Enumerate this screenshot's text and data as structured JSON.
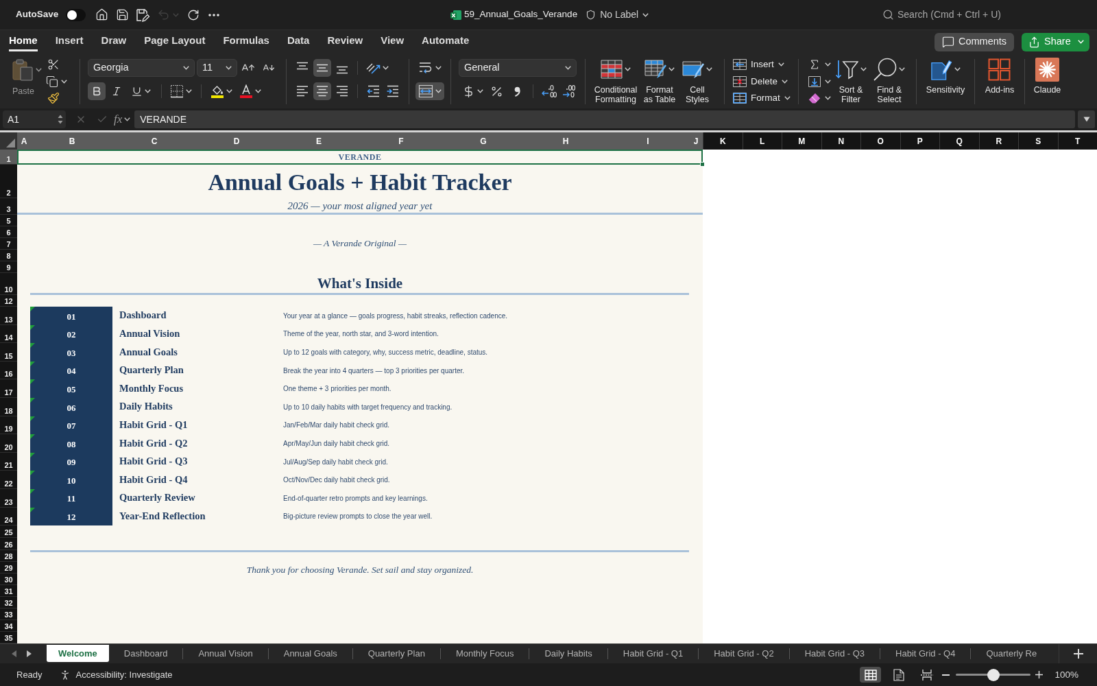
{
  "title_bar": {
    "autosave": {
      "label": "AutoSave",
      "on": false
    },
    "quick_access": [
      {
        "kind": "home",
        "disabled": false
      },
      {
        "kind": "save",
        "disabled": false
      },
      {
        "kind": "save_as",
        "disabled": false
      },
      {
        "kind": "undo",
        "disabled": true
      },
      {
        "kind": "redo",
        "disabled": false
      },
      {
        "kind": "more",
        "disabled": false
      }
    ],
    "file_name": "59_Annual_Goals_Verande",
    "sensitivity_label": "No Label",
    "search": {
      "placeholder": "Search (Cmd + Ctrl + U)"
    }
  },
  "ribbon_tabs": [
    {
      "label": "Home",
      "selected": true
    },
    {
      "label": "Insert",
      "selected": false
    },
    {
      "label": "Draw",
      "selected": false
    },
    {
      "label": "Page Layout",
      "selected": false
    },
    {
      "label": "Formulas",
      "selected": false
    },
    {
      "label": "Data",
      "selected": false
    },
    {
      "label": "Review",
      "selected": false
    },
    {
      "label": "View",
      "selected": false
    },
    {
      "label": "Automate",
      "selected": false
    }
  ],
  "ribbon": {
    "comments": "Comments",
    "share": "Share",
    "paste": {
      "label": "Paste",
      "disabled": true
    },
    "font_name": "Georgia",
    "font_size": "11",
    "font_styles": [
      {
        "kind": "bold",
        "selected": true
      },
      {
        "kind": "italic",
        "selected": false
      },
      {
        "kind": "underline",
        "selected": false
      }
    ],
    "vertical_align": [
      {
        "kind": "top",
        "selected": false
      },
      {
        "kind": "middle",
        "selected": true
      },
      {
        "kind": "bottom",
        "selected": false
      }
    ],
    "horizontal_align": [
      {
        "kind": "left",
        "selected": false
      },
      {
        "kind": "center",
        "selected": true
      },
      {
        "kind": "right",
        "selected": false
      }
    ],
    "merge_selected": true,
    "number_format": "General",
    "style_buttons": [
      {
        "kind": "conditional_formatting",
        "lines": [
          "Conditional",
          "Formatting"
        ]
      },
      {
        "kind": "format_as_table",
        "lines": [
          "Format",
          "as Table"
        ]
      },
      {
        "kind": "cell_styles",
        "lines": [
          "Cell",
          "Styles"
        ]
      }
    ],
    "cell_actions": [
      {
        "kind": "insert",
        "label": "Insert"
      },
      {
        "kind": "delete",
        "label": "Delete"
      },
      {
        "kind": "format",
        "label": "Format"
      }
    ],
    "editing_buttons": [
      {
        "kind": "sort_filter",
        "lines": [
          "Sort &",
          "Filter"
        ]
      },
      {
        "kind": "find_select",
        "lines": [
          "Find &",
          "Select"
        ]
      }
    ],
    "extra_buttons": [
      {
        "kind": "sensitivity",
        "label": "Sensitivity"
      },
      {
        "kind": "add_ins",
        "label": "Add-ins"
      },
      {
        "kind": "claude",
        "label": "Claude"
      }
    ]
  },
  "formula_bar": {
    "name_box": "A1",
    "function_label": "fx",
    "formula": "VERANDE"
  },
  "columns": [
    {
      "label": "A",
      "selected": true
    },
    {
      "label": "B",
      "selected": true
    },
    {
      "label": "C",
      "selected": true
    },
    {
      "label": "D",
      "selected": true
    },
    {
      "label": "E",
      "selected": true
    },
    {
      "label": "F",
      "selected": true
    },
    {
      "label": "G",
      "selected": true
    },
    {
      "label": "H",
      "selected": true
    },
    {
      "label": "I",
      "selected": true
    },
    {
      "label": "J",
      "selected": true
    },
    {
      "label": "K",
      "selected": false
    },
    {
      "label": "L",
      "selected": false
    },
    {
      "label": "M",
      "selected": false
    },
    {
      "label": "N",
      "selected": false
    },
    {
      "label": "O",
      "selected": false
    },
    {
      "label": "P",
      "selected": false
    },
    {
      "label": "Q",
      "selected": false
    },
    {
      "label": "R",
      "selected": false
    },
    {
      "label": "S",
      "selected": false
    },
    {
      "label": "T",
      "selected": false
    }
  ],
  "rows": [
    {
      "label": "1",
      "selected": true
    },
    {
      "label": "2",
      "selected": false
    },
    {
      "label": "3",
      "selected": false
    },
    {
      "label": "5",
      "selected": false
    },
    {
      "label": "6",
      "selected": false
    },
    {
      "label": "7",
      "selected": false
    },
    {
      "label": "8",
      "selected": false
    },
    {
      "label": "9",
      "selected": false
    },
    {
      "label": "10",
      "selected": false
    },
    {
      "label": "12",
      "selected": false
    },
    {
      "label": "13",
      "selected": false
    },
    {
      "label": "14",
      "selected": false
    },
    {
      "label": "15",
      "selected": false
    },
    {
      "label": "16",
      "selected": false
    },
    {
      "label": "17",
      "selected": false
    },
    {
      "label": "18",
      "selected": false
    },
    {
      "label": "19",
      "selected": false
    },
    {
      "label": "20",
      "selected": false
    },
    {
      "label": "21",
      "selected": false
    },
    {
      "label": "22",
      "selected": false
    },
    {
      "label": "23",
      "selected": false
    },
    {
      "label": "24",
      "selected": false
    },
    {
      "label": "25",
      "selected": false
    },
    {
      "label": "26",
      "selected": false
    },
    {
      "label": "28",
      "selected": false
    },
    {
      "label": "29",
      "selected": false
    },
    {
      "label": "30",
      "selected": false
    },
    {
      "label": "31",
      "selected": false
    },
    {
      "label": "32",
      "selected": false
    },
    {
      "label": "33",
      "selected": false
    },
    {
      "label": "34",
      "selected": false
    },
    {
      "label": "35",
      "selected": false
    }
  ],
  "sheet": {
    "brand": "VERANDE",
    "brand_cell_selected": true,
    "title": "Annual Goals + Habit Tracker",
    "subtitle": "2026 — your most aligned year yet",
    "tagline": "— A Verande Original —",
    "section_heading": "What's Inside",
    "contents": [
      {
        "number": "01",
        "name": "Dashboard",
        "description": "Your year at a glance — goals progress, habit streaks, reflection cadence.",
        "flagged": true
      },
      {
        "number": "02",
        "name": "Annual Vision",
        "description": "Theme of the year, north star, and 3-word intention.",
        "flagged": true
      },
      {
        "number": "03",
        "name": "Annual Goals",
        "description": "Up to 12 goals with category, why, success metric, deadline, status.",
        "flagged": true
      },
      {
        "number": "04",
        "name": "Quarterly Plan",
        "description": "Break the year into 4 quarters — top 3 priorities per quarter.",
        "flagged": true
      },
      {
        "number": "05",
        "name": "Monthly Focus",
        "description": "One theme + 3 priorities per month.",
        "flagged": true
      },
      {
        "number": "06",
        "name": "Daily Habits",
        "description": "Up to 10 daily habits with target frequency and tracking.",
        "flagged": true
      },
      {
        "number": "07",
        "name": "Habit Grid - Q1",
        "description": "Jan/Feb/Mar daily habit check grid.",
        "flagged": true
      },
      {
        "number": "08",
        "name": "Habit Grid - Q2",
        "description": "Apr/May/Jun daily habit check grid.",
        "flagged": true
      },
      {
        "number": "09",
        "name": "Habit Grid - Q3",
        "description": "Jul/Aug/Sep daily habit check grid.",
        "flagged": true
      },
      {
        "number": "10",
        "name": "Habit Grid - Q4",
        "description": "Oct/Nov/Dec daily habit check grid.",
        "flagged": true
      },
      {
        "number": "11",
        "name": "Quarterly Review",
        "description": "End-of-quarter retro prompts and key learnings.",
        "flagged": true
      },
      {
        "number": "12",
        "name": "Year-End Reflection",
        "description": "Big-picture review prompts to close the year well.",
        "flagged": true
      }
    ],
    "closing": "Thank you for choosing Verande. Set sail and stay organized."
  },
  "sheet_tabs": [
    {
      "label": "Welcome",
      "selected": true
    },
    {
      "label": "Dashboard",
      "selected": false
    },
    {
      "label": "Annual Vision",
      "selected": false
    },
    {
      "label": "Annual Goals",
      "selected": false
    },
    {
      "label": "Quarterly Plan",
      "selected": false
    },
    {
      "label": "Monthly Focus",
      "selected": false
    },
    {
      "label": "Daily Habits",
      "selected": false
    },
    {
      "label": "Habit Grid - Q1",
      "selected": false
    },
    {
      "label": "Habit Grid - Q2",
      "selected": false
    },
    {
      "label": "Habit Grid - Q3",
      "selected": false
    },
    {
      "label": "Habit Grid - Q4",
      "selected": false
    },
    {
      "label": "Quarterly Re",
      "selected": false
    }
  ],
  "status_bar": {
    "status": "Ready",
    "accessibility": "Accessibility: Investigate",
    "views": [
      {
        "kind": "normal",
        "selected": true
      },
      {
        "kind": "page_layout",
        "selected": false
      },
      {
        "kind": "page_break",
        "selected": false
      }
    ],
    "zoom": {
      "level": 0.5,
      "reading": "100%"
    }
  }
}
